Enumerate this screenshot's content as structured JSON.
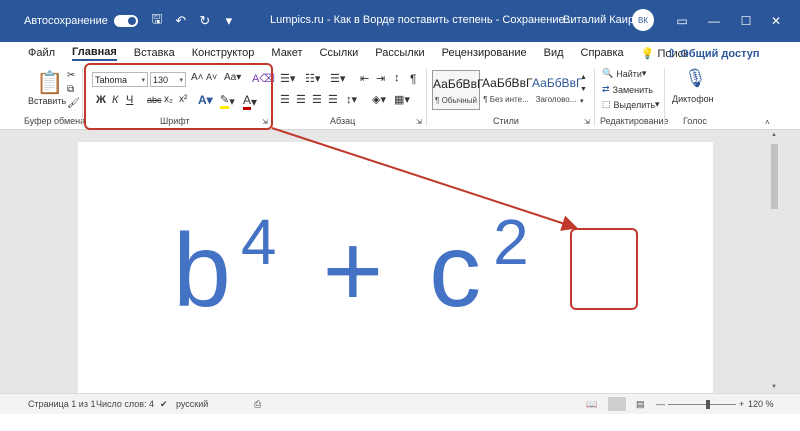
{
  "titlebar": {
    "autosave_label": "Автосохранение",
    "doc_title": "Lumpics.ru - Как в Ворде поставить степень - Сохранение...",
    "user_name": "Виталий Каиров",
    "avatar_initials": "ВК"
  },
  "tabs": [
    "Файл",
    "Главная",
    "Вставка",
    "Конструктор",
    "Макет",
    "Ссылки",
    "Рассылки",
    "Рецензирование",
    "Вид",
    "Справка",
    "Поиск"
  ],
  "share_label": "Общий доступ",
  "ribbon": {
    "clipboard": {
      "paste_label": "Вставить",
      "group_label": "Буфер обмена"
    },
    "font": {
      "font_name": "Tahoma",
      "font_size": "130",
      "group_label": "Шрифт",
      "bold": "Ж",
      "italic": "К",
      "underline": "Ч",
      "strike": "abc",
      "subscript": "x₂",
      "superscript": "x²"
    },
    "paragraph": {
      "group_label": "Абзац"
    },
    "styles": {
      "group_label": "Стили",
      "items": [
        {
          "sample": "АаБбВвГ",
          "name": "¶ Обычный"
        },
        {
          "sample": "АаБбВвГ",
          "name": "¶ Без инте..."
        },
        {
          "sample": "АаБбВвГ",
          "name": "Заголово..."
        }
      ]
    },
    "editing": {
      "find": "Найти",
      "replace": "Заменить",
      "select": "Выделить",
      "group_label": "Редактирование"
    },
    "voice": {
      "dictate": "Диктофон",
      "group_label": "Голос"
    }
  },
  "document": {
    "base1": "b",
    "sup1": "4",
    "operator": "+",
    "base2": "c",
    "sup2": "2"
  },
  "statusbar": {
    "page": "Страница 1 из 1",
    "words": "Число слов: 4",
    "language": "русский",
    "zoom": "120 %",
    "zoom_fraction": 0.6
  },
  "colors": {
    "accent": "#2b579a",
    "formula": "#4472c4",
    "highlight": "#c0392b"
  }
}
